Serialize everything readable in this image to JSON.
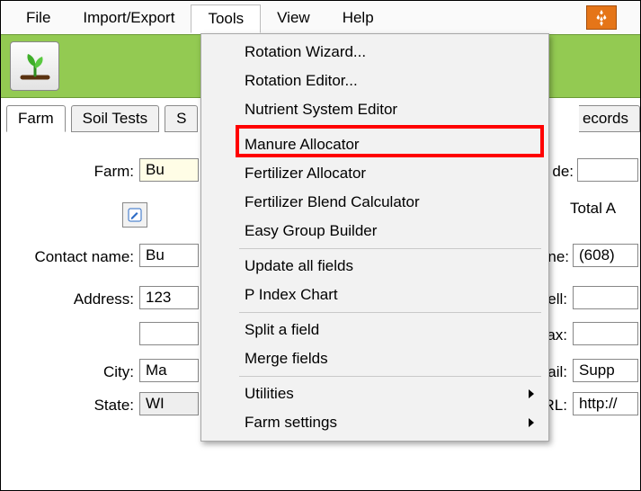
{
  "menubar": {
    "file": "File",
    "import_export": "Import/Export",
    "tools": "Tools",
    "view": "View",
    "help": "Help"
  },
  "tabs": {
    "farm": "Farm",
    "soil_tests": "Soil Tests",
    "s_cut": "S",
    "records_cut": "ecords"
  },
  "form": {
    "farm_label": "Farm:",
    "farm_value": "Bu",
    "de_label": "de:",
    "de_value": "",
    "total_a_label": "Total A",
    "contact_label": "Contact name:",
    "contact_value": "Bu",
    "phone_label": "ne:",
    "phone_value": "(608)",
    "address_label": "Address:",
    "address_value": "123",
    "ell_label": "ell:",
    "ell_value": "",
    "address2_value": "",
    "ax_label": "ax:",
    "ax_value": "",
    "city_label": "City:",
    "city_value": "Ma",
    "ail_label": "ail:",
    "ail_value": "Supp",
    "state_label": "State:",
    "state_value": "WI",
    "rl_label": "RL:",
    "rl_value": "http://"
  },
  "dropdown": {
    "rotation_wizard": "Rotation Wizard...",
    "rotation_editor": "Rotation Editor...",
    "nutrient_system_editor": "Nutrient System Editor",
    "manure_allocator": "Manure Allocator",
    "fertilizer_allocator": "Fertilizer Allocator",
    "fertilizer_blend_calculator": "Fertilizer Blend Calculator",
    "easy_group_builder": "Easy Group Builder",
    "update_all_fields": "Update all fields",
    "p_index_chart": "P Index Chart",
    "split_field": "Split a field",
    "merge_fields": "Merge fields",
    "utilities": "Utilities",
    "farm_settings": "Farm settings"
  },
  "colors": {
    "green_band": "#93ca52",
    "orange_accent": "#e57518",
    "highlight_red": "#f00"
  }
}
